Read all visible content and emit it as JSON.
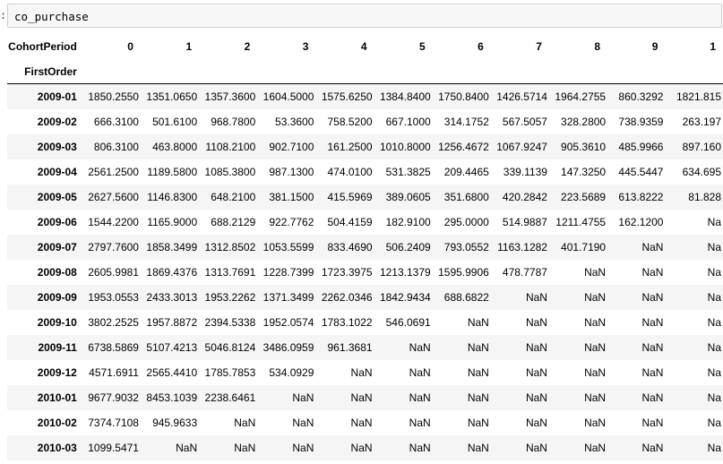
{
  "prompt_marker": ":",
  "code_cell": {
    "code": "co_purchase"
  },
  "table": {
    "columns_name": "CohortPeriod",
    "columns": [
      "0",
      "1",
      "2",
      "3",
      "4",
      "5",
      "6",
      "7",
      "8",
      "9",
      "1"
    ],
    "index_name": "FirstOrder",
    "rows": [
      {
        "index": "2009-01",
        "values": [
          "1850.2550",
          "1351.0650",
          "1357.3600",
          "1604.5000",
          "1575.6250",
          "1384.8400",
          "1750.8400",
          "1426.5714",
          "1964.2755",
          "860.3292",
          "1821.815"
        ]
      },
      {
        "index": "2009-02",
        "values": [
          "666.3100",
          "501.6100",
          "968.7800",
          "53.3600",
          "758.5200",
          "667.1000",
          "314.1752",
          "567.5057",
          "328.2800",
          "738.9359",
          "263.197"
        ]
      },
      {
        "index": "2009-03",
        "values": [
          "806.3100",
          "463.8000",
          "1108.2100",
          "902.7100",
          "161.2500",
          "1010.8000",
          "1256.4672",
          "1067.9247",
          "905.3610",
          "485.9966",
          "897.160"
        ]
      },
      {
        "index": "2009-04",
        "values": [
          "2561.2500",
          "1189.5800",
          "1085.3800",
          "987.1300",
          "474.0100",
          "531.3825",
          "209.4465",
          "339.1139",
          "147.3250",
          "445.5447",
          "634.695"
        ]
      },
      {
        "index": "2009-05",
        "values": [
          "2627.5600",
          "1146.8300",
          "648.2100",
          "381.1500",
          "415.5969",
          "389.0605",
          "351.6800",
          "420.2842",
          "223.5689",
          "613.8222",
          "81.828"
        ]
      },
      {
        "index": "2009-06",
        "values": [
          "1544.2200",
          "1165.9000",
          "688.2129",
          "922.7762",
          "504.4159",
          "182.9100",
          "295.0000",
          "514.9887",
          "1211.4755",
          "162.1200",
          "Na"
        ]
      },
      {
        "index": "2009-07",
        "values": [
          "2797.7600",
          "1858.3499",
          "1312.8502",
          "1053.5599",
          "833.4690",
          "506.2409",
          "793.0552",
          "1163.1282",
          "401.7190",
          "NaN",
          "Na"
        ]
      },
      {
        "index": "2009-08",
        "values": [
          "2605.9981",
          "1869.4376",
          "1313.7691",
          "1228.7399",
          "1723.3975",
          "1213.1379",
          "1595.9906",
          "478.7787",
          "NaN",
          "NaN",
          "Na"
        ]
      },
      {
        "index": "2009-09",
        "values": [
          "1953.0553",
          "2433.3013",
          "1953.2262",
          "1371.3499",
          "2262.0346",
          "1842.9434",
          "688.6822",
          "NaN",
          "NaN",
          "NaN",
          "Na"
        ]
      },
      {
        "index": "2009-10",
        "values": [
          "3802.2525",
          "1957.8872",
          "2394.5338",
          "1952.0574",
          "1783.1022",
          "546.0691",
          "NaN",
          "NaN",
          "NaN",
          "NaN",
          "Na"
        ]
      },
      {
        "index": "2009-11",
        "values": [
          "6738.5869",
          "5107.4213",
          "5046.8124",
          "3486.0959",
          "961.3681",
          "NaN",
          "NaN",
          "NaN",
          "NaN",
          "NaN",
          "Na"
        ]
      },
      {
        "index": "2009-12",
        "values": [
          "4571.6911",
          "2565.4410",
          "1785.7853",
          "534.0929",
          "NaN",
          "NaN",
          "NaN",
          "NaN",
          "NaN",
          "NaN",
          "Na"
        ]
      },
      {
        "index": "2010-01",
        "values": [
          "9677.9032",
          "8453.1039",
          "2238.6461",
          "NaN",
          "NaN",
          "NaN",
          "NaN",
          "NaN",
          "NaN",
          "NaN",
          "Na"
        ]
      },
      {
        "index": "2010-02",
        "values": [
          "7374.7108",
          "945.9633",
          "NaN",
          "NaN",
          "NaN",
          "NaN",
          "NaN",
          "NaN",
          "NaN",
          "NaN",
          "Na"
        ]
      },
      {
        "index": "2010-03",
        "values": [
          "1099.5471",
          "NaN",
          "NaN",
          "NaN",
          "NaN",
          "NaN",
          "NaN",
          "NaN",
          "NaN",
          "NaN",
          "Na"
        ]
      }
    ]
  }
}
